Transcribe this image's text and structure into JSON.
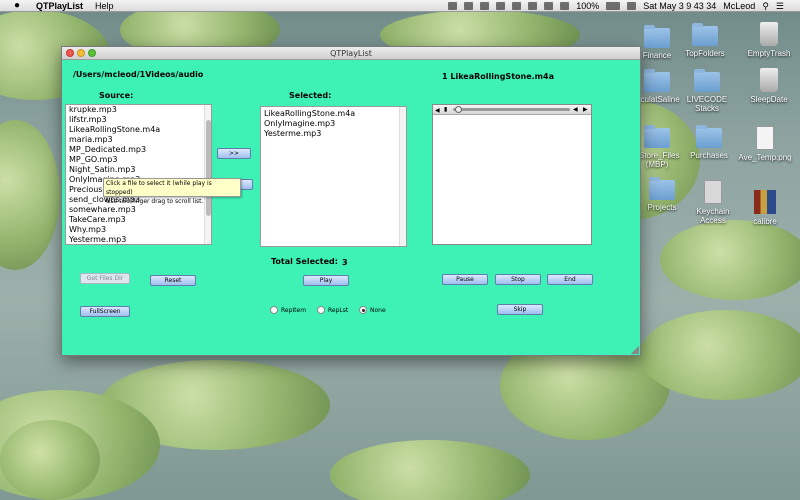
{
  "menubar": {
    "app_name": "QTPlayList",
    "menu_help": "Help",
    "battery": "100%",
    "clock": "Sat May 3  9 43 34",
    "user": "McLeod"
  },
  "desktop_icons": [
    {
      "label": "Finance"
    },
    {
      "label": "TopFolders"
    },
    {
      "label": "EmptyTrash"
    },
    {
      "label": "alculatSaline"
    },
    {
      "label": "LIVECODE Stacks"
    },
    {
      "label": "SleepDate"
    },
    {
      "label": "pStore_Files (MBP)"
    },
    {
      "label": "Purchases"
    },
    {
      "label": "Ave_Temp.png"
    },
    {
      "label": "Projects"
    },
    {
      "label": "Keychain Access"
    },
    {
      "label": "calibre"
    }
  ],
  "window": {
    "title": "QTPlayList",
    "folder_path": "/Users/mcleod/1Videos/audio",
    "now_playing": "1 LikeaRollingStone.m4a",
    "source_label": "Source:",
    "selected_label": "Selected:",
    "total_selected_label": "Total Selected:",
    "total_selected_value": "3",
    "source_files": [
      "krupke.mp3",
      "lifstr.mp3",
      "LikeaRollingStone.m4a",
      "maria.mp3",
      "MP_Dedicated.mp3",
      "MP_GO.mp3",
      "Night_Satin.mp3",
      "OnlyImagine.mp3",
      "Precious.mp3",
      "send_clowns.mp3",
      "somewhare.mp3",
      "TakeCare.mp3",
      "Why.mp3",
      "Yesterme.mp3"
    ],
    "selected_files": [
      "LikeaRollingStone.m4a",
      "OnlyImagine.mp3",
      "Yesterme.mp3"
    ],
    "tooltip": {
      "line1": "Click a file to select it (while play is stopped)",
      "line2": "Use two finger drag to scroll list."
    },
    "buttons": {
      "add": ">>",
      "get_files": "Get Files Dir",
      "reset": "Reset",
      "fullscreen": "FullScreen",
      "play": "Play",
      "pause": "Pause",
      "stop": "Stop",
      "end": "End",
      "skip": "Skip"
    },
    "radios": {
      "rep_item": "RepItem",
      "rep_list": "RepLst",
      "none": "None",
      "selected": "None"
    },
    "scroll": {
      "source_position": 0.35
    }
  },
  "colors": {
    "window_bg": "#3ef2b6",
    "button_blue": "#9fbfee",
    "tooltip_bg": "#ffffc8"
  }
}
